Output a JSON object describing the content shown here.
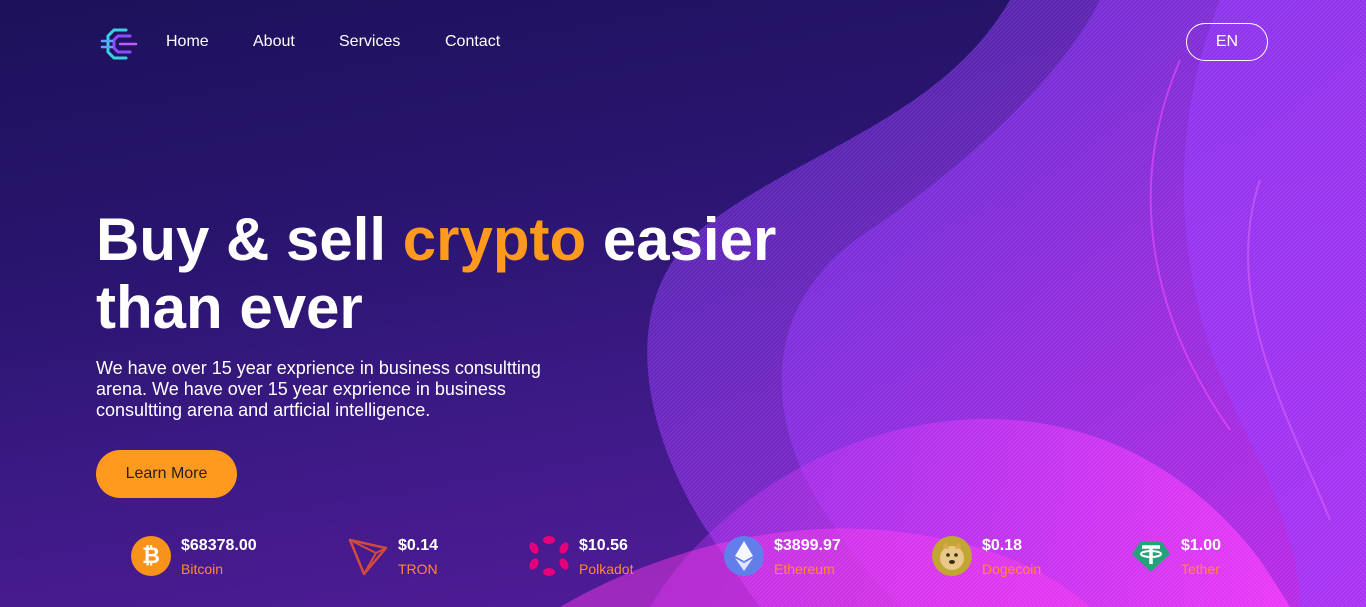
{
  "nav": {
    "links": [
      {
        "label": "Home"
      },
      {
        "label": "About"
      },
      {
        "label": "Services"
      },
      {
        "label": "Contact"
      }
    ],
    "language": "EN"
  },
  "hero": {
    "title_part1": "Buy & sell ",
    "title_accent": "crypto",
    "title_part2": " easier than ever",
    "description": "We have over 15 year exprience in business consultting arena. We have over 15 year exprience in business consultting arena and artficial intelligence.",
    "cta_label": "Learn More"
  },
  "coins": [
    {
      "price": "$68378.00",
      "name": "Bitcoin",
      "icon": "bitcoin-icon"
    },
    {
      "price": "$0.14",
      "name": "TRON",
      "icon": "tron-icon"
    },
    {
      "price": "$10.56",
      "name": "Polkadot",
      "icon": "polkadot-icon"
    },
    {
      "price": "$3899.97",
      "name": "Ethereum",
      "icon": "ethereum-icon"
    },
    {
      "price": "$0.18",
      "name": "Dogecoin",
      "icon": "dogecoin-icon"
    },
    {
      "price": "$1.00",
      "name": "Tether",
      "icon": "tether-icon"
    }
  ],
  "colors": {
    "accent": "#ff9a1f",
    "coin_name": "#ff8a2a",
    "background": "#2a1570",
    "wave_magenta": "#e030ff",
    "wave_violet": "#7b3cff"
  }
}
